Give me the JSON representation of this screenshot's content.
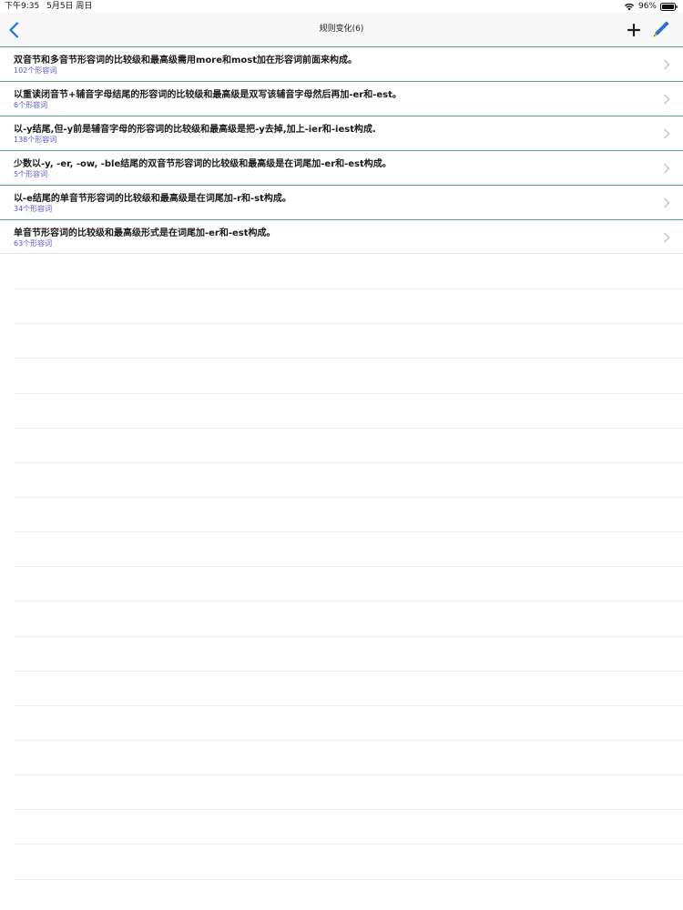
{
  "status_bar": {
    "time": "下午9:35",
    "date": "5月5日 周日",
    "battery": "96%"
  },
  "nav": {
    "title": "规则变化(6)",
    "back_icon": "chevron-left-icon",
    "add_icon": "plus-icon",
    "edit_icon": "pencil-icon",
    "accent_color": "#1a73e8"
  },
  "rules": [
    {
      "title": "双音节和多音节形容词的比较级和最高级需用more和most加在形容词前面来构成。",
      "count": "102个形容词"
    },
    {
      "title": "以重读闭音节+辅音字母结尾的形容词的比较级和最高级是双写该辅音字母然后再加-er和-est。",
      "count": "6个形容词"
    },
    {
      "title": "以-y结尾,但-y前是辅音字母的形容词的比较级和最高级是把-y去掉,加上-ier和-iest构成.",
      "count": "138个形容词"
    },
    {
      "title": "少数以-y, -er, -ow, -ble结尾的双音节形容词的比较级和最高级是在词尾加-er和-est构成。",
      "count": "5个形容词"
    },
    {
      "title": "以-e结尾的单音节形容词的比较级和最高级是在词尾加-r和-st构成。",
      "count": "34个形容词"
    },
    {
      "title": "单音节形容词的比较级和最高级形式是在词尾加-er和-est构成。",
      "count": "63个形容词"
    }
  ]
}
